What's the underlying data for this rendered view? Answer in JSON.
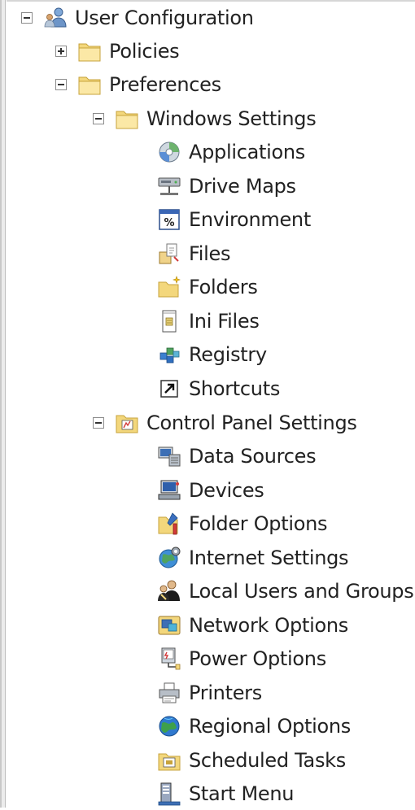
{
  "tree": {
    "root": {
      "label": "User Configuration",
      "icon": "user-icon",
      "expanded": true
    },
    "policies": {
      "label": "Policies",
      "icon": "folder-icon",
      "expanded": false
    },
    "preferences": {
      "label": "Preferences",
      "icon": "folder-icon",
      "expanded": true
    },
    "windows_settings": {
      "label": "Windows Settings",
      "icon": "folder-icon",
      "expanded": true,
      "items": [
        {
          "label": "Applications",
          "icon": "applications-icon"
        },
        {
          "label": "Drive Maps",
          "icon": "drive-maps-icon"
        },
        {
          "label": "Environment",
          "icon": "environment-icon"
        },
        {
          "label": "Files",
          "icon": "files-icon"
        },
        {
          "label": "Folders",
          "icon": "folders-icon"
        },
        {
          "label": "Ini Files",
          "icon": "ini-files-icon"
        },
        {
          "label": "Registry",
          "icon": "registry-icon"
        },
        {
          "label": "Shortcuts",
          "icon": "shortcuts-icon"
        }
      ]
    },
    "control_panel": {
      "label": "Control Panel Settings",
      "icon": "control-panel-folder-icon",
      "expanded": true,
      "items": [
        {
          "label": "Data Sources",
          "icon": "data-sources-icon"
        },
        {
          "label": "Devices",
          "icon": "devices-icon"
        },
        {
          "label": "Folder Options",
          "icon": "folder-options-icon"
        },
        {
          "label": "Internet Settings",
          "icon": "internet-settings-icon"
        },
        {
          "label": "Local Users and Groups",
          "icon": "local-users-groups-icon"
        },
        {
          "label": "Network Options",
          "icon": "network-options-icon"
        },
        {
          "label": "Power Options",
          "icon": "power-options-icon"
        },
        {
          "label": "Printers",
          "icon": "printers-icon"
        },
        {
          "label": "Regional Options",
          "icon": "regional-options-icon"
        },
        {
          "label": "Scheduled Tasks",
          "icon": "scheduled-tasks-icon"
        },
        {
          "label": "Start Menu",
          "icon": "start-menu-icon"
        }
      ]
    }
  }
}
